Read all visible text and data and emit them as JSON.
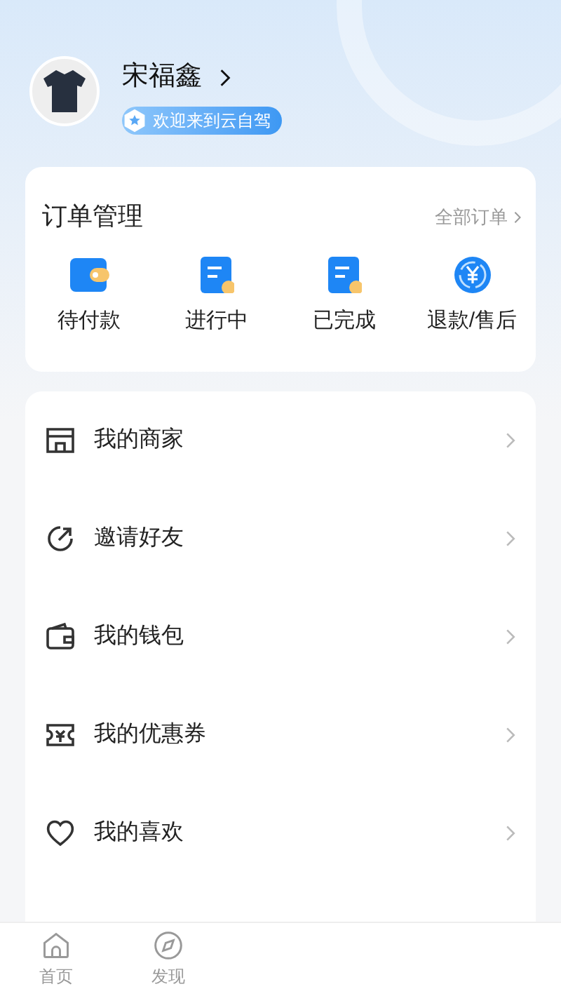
{
  "profile": {
    "name": "宋福鑫",
    "badge": "欢迎来到云自驾"
  },
  "orders": {
    "title": "订单管理",
    "all_link": "全部订单",
    "items": [
      {
        "kind": "wallet",
        "label": "待付款"
      },
      {
        "kind": "doc",
        "label": "进行中"
      },
      {
        "kind": "doc",
        "label": "已完成"
      },
      {
        "kind": "refund",
        "label": "退款/售后"
      }
    ]
  },
  "menu": [
    {
      "kind": "shop",
      "label": "我的商家"
    },
    {
      "kind": "invite",
      "label": "邀请好友"
    },
    {
      "kind": "wallet",
      "label": "我的钱包"
    },
    {
      "kind": "coupon",
      "label": "我的优惠券"
    },
    {
      "kind": "heart",
      "label": "我的喜欢"
    }
  ],
  "tab_bar": [
    {
      "kind": "home",
      "label": "首页",
      "selected": false
    },
    {
      "kind": "discover",
      "label": "发现",
      "selected": false
    }
  ]
}
